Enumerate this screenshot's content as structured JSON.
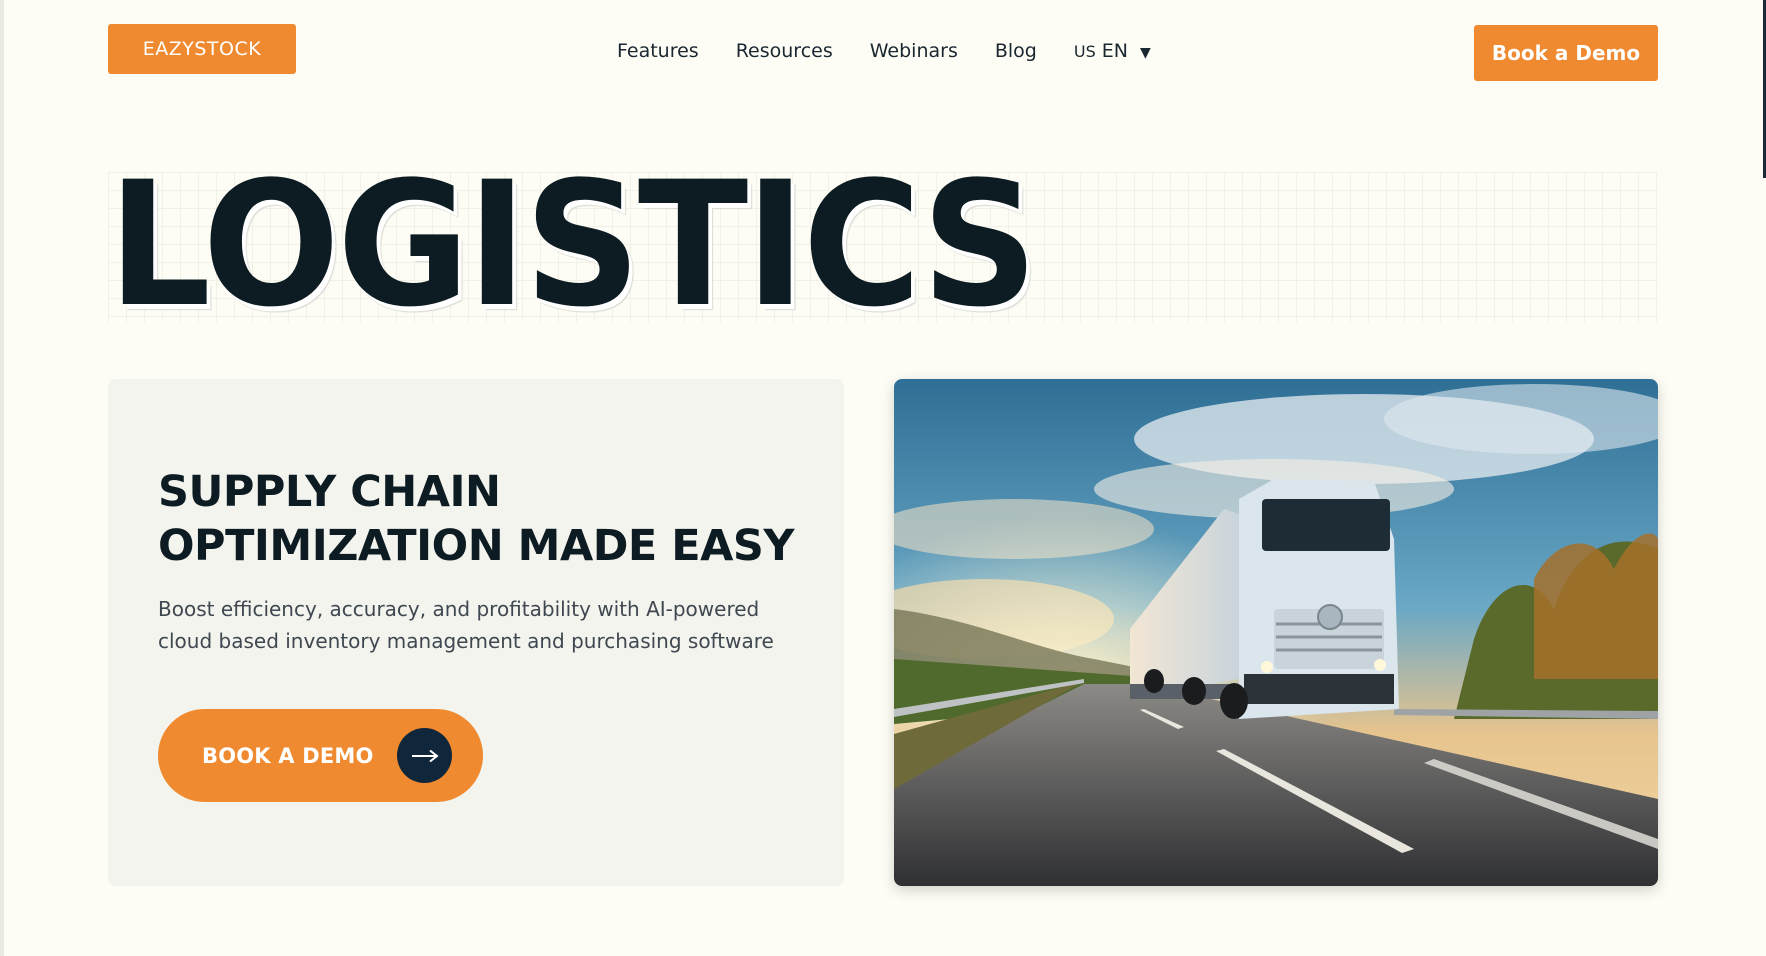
{
  "header": {
    "logo_text": "EAZYSTOCK",
    "nav": [
      {
        "label": "Features"
      },
      {
        "label": "Resources"
      },
      {
        "label": "Webinars"
      },
      {
        "label": "Blog"
      }
    ],
    "language": {
      "flag": "US",
      "code": "EN",
      "caret": "▼"
    },
    "cta_label": "Book a Demo"
  },
  "hero": {
    "headline": "LOGISTICS",
    "card": {
      "title": "SUPPLY CHAIN OPTIMIZATION MADE EASY",
      "subtitle": "Boost efficiency, accuracy, and profitability with AI-powered cloud based inventory management and purchasing software",
      "cta_label": "BOOK A DEMO",
      "cta_icon": "arrow-right-icon"
    },
    "image": {
      "subject": "truck-on-highway-image"
    }
  },
  "colors": {
    "accent": "#f08a30",
    "dark": "#0d1b22",
    "navy": "#10263a",
    "background": "#fdfdf5",
    "card": "#f4f4ee"
  }
}
